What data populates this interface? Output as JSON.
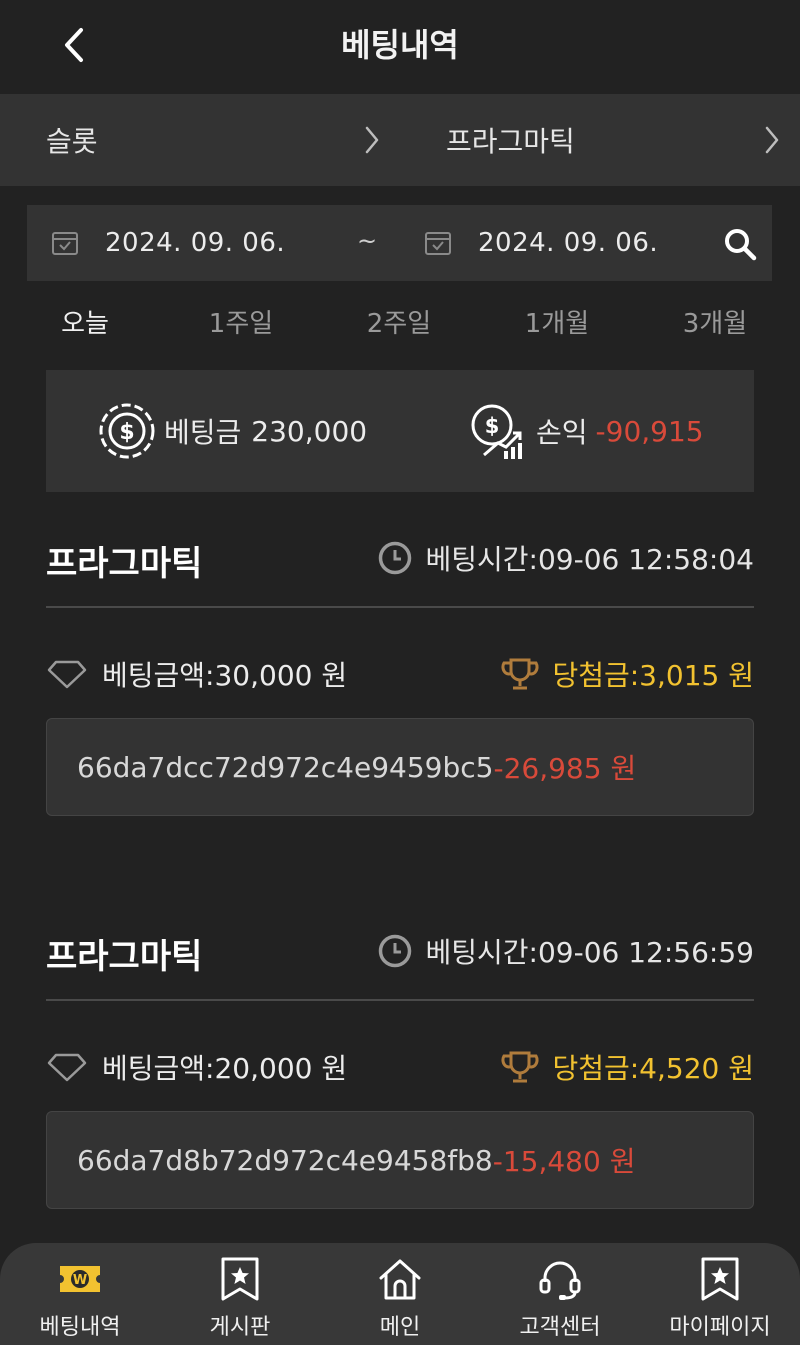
{
  "header": {
    "title": "베팅내역",
    "back_icon": "chevron-left-icon"
  },
  "categories": {
    "left": "슬롯",
    "right": "프라그마틱"
  },
  "date_range": {
    "start": "2024. 09. 06.",
    "separator": "~",
    "end": "2024. 09. 06.",
    "search_icon": "search-icon"
  },
  "periods": [
    "오늘",
    "1주일",
    "2주일",
    "1개월",
    "3개월"
  ],
  "summary": {
    "bet_label": "베팅금",
    "bet_value": "230,000",
    "profit_label": "손익",
    "profit_value": "-90,915"
  },
  "bets": [
    {
      "provider": "프라그마틱",
      "bet_time": "베팅시간:09-06 12:58:04",
      "bet_amount": "베팅금액:30,000 원",
      "win_amount": "당첨금:3,015 원",
      "round_id": "66da7dcc72d972c4e9459bc5",
      "net": "-26,985 원"
    },
    {
      "provider": "프라그마틱",
      "bet_time": "베팅시간:09-06 12:56:59",
      "bet_amount": "베팅금액:20,000 원",
      "win_amount": "당첨금:4,520 원",
      "round_id": "66da7d8b72d972c4e9458fb8",
      "net": "-15,480 원"
    }
  ],
  "bottom_nav": [
    {
      "label": "베팅내역",
      "icon": "ticket-icon"
    },
    {
      "label": "게시판",
      "icon": "bookmark-star-icon"
    },
    {
      "label": "메인",
      "icon": "home-icon"
    },
    {
      "label": "고객센터",
      "icon": "headset-icon"
    },
    {
      "label": "마이페이지",
      "icon": "bookmark-star-icon"
    }
  ],
  "colors": {
    "background": "#222222",
    "panel": "#333333",
    "negative": "#d94a3a",
    "win": "#f2c230",
    "accent_icon": "#f2c230"
  }
}
